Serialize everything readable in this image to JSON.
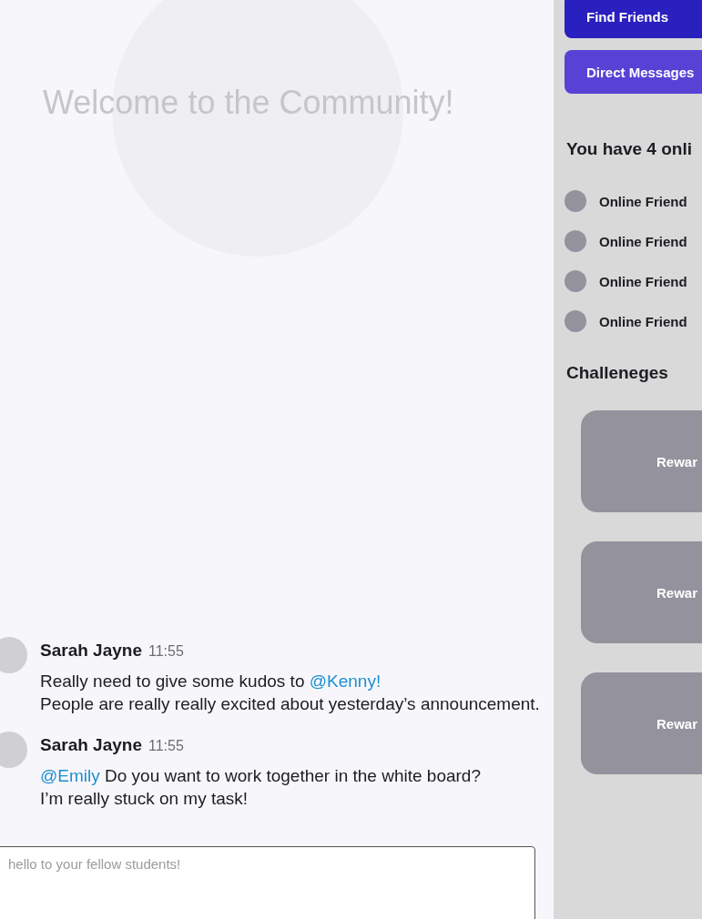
{
  "main": {
    "title": "Welcome to the Community!",
    "messages": [
      {
        "author": "Sarah Jayne",
        "time": "11:55",
        "lines": [
          [
            {
              "kind": "plain",
              "text": "Really need to give some kudos to "
            },
            {
              "kind": "mention",
              "text": "@Kenny!"
            }
          ],
          [
            {
              "kind": "plain",
              "text": "People are really really excited about yesterday’s announcement."
            }
          ]
        ]
      },
      {
        "author": "Sarah Jayne",
        "time": "11:55",
        "lines": [
          [
            {
              "kind": "mention",
              "text": "@Emily"
            },
            {
              "kind": "plain",
              "text": " Do you want to work together in the white board?"
            }
          ],
          [
            {
              "kind": "plain",
              "text": "I’m really stuck on my task!"
            }
          ]
        ]
      }
    ],
    "composer": {
      "placeholder": "hello to your fellow students!"
    }
  },
  "sidebar": {
    "buttons": [
      {
        "label": "Find Friends",
        "kind": "primary"
      },
      {
        "label": "Direct Messages",
        "kind": "secondary"
      }
    ],
    "online_heading": "You have 4 onli",
    "friends": [
      {
        "name": "Online Friend"
      },
      {
        "name": "Online Friend"
      },
      {
        "name": "Online Friend"
      },
      {
        "name": "Online Friend"
      }
    ],
    "challenges_heading": "Challeneges",
    "challenges": [
      {
        "label": "Rewar"
      },
      {
        "label": "Rewar"
      },
      {
        "label": "Rewar"
      }
    ]
  }
}
